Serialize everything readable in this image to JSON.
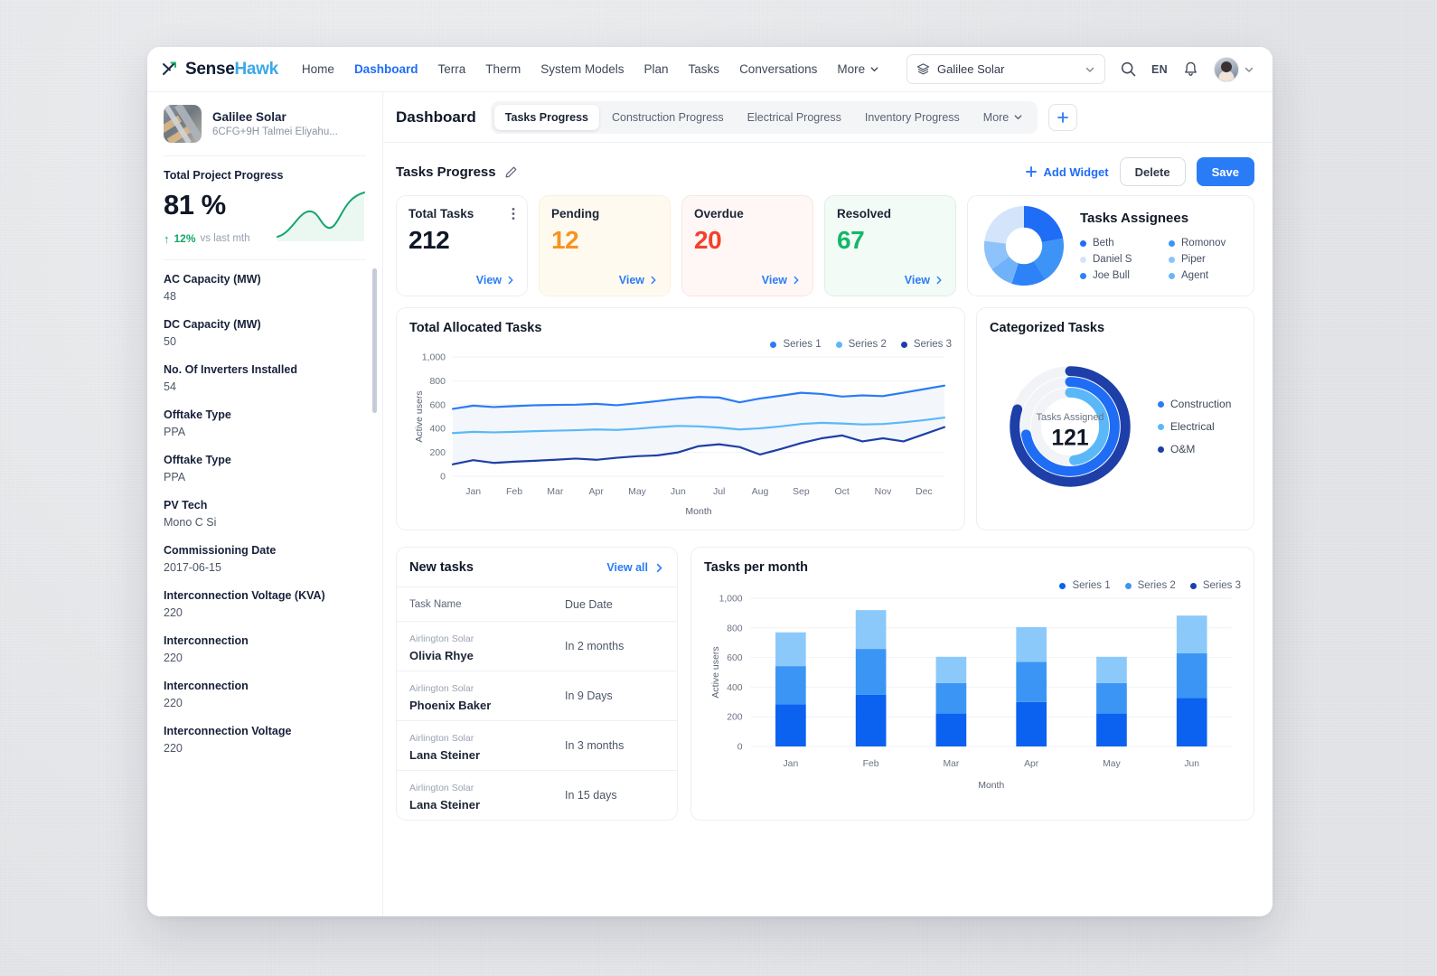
{
  "brand": {
    "name_part1": "Sense",
    "name_part2": "Hawk",
    "logo_icon": "sensehawk-arrows-icon"
  },
  "nav": {
    "links": [
      {
        "label": "Home",
        "active": false
      },
      {
        "label": "Dashboard",
        "active": true
      },
      {
        "label": "Terra",
        "active": false
      },
      {
        "label": "Therm",
        "active": false
      },
      {
        "label": "System Models",
        "active": false
      },
      {
        "label": "Plan",
        "active": false
      },
      {
        "label": "Tasks",
        "active": false
      },
      {
        "label": "Conversations",
        "active": false
      },
      {
        "label": "More",
        "active": false
      }
    ],
    "project_selector": {
      "value": "Galilee Solar",
      "icon": "layers-icon",
      "chevron": "chevron-down-icon"
    },
    "search_icon": "search-icon",
    "language": "EN",
    "notifications_icon": "bell-icon",
    "avatar_icon": "user-avatar"
  },
  "sidebar": {
    "project": {
      "name": "Galilee Solar",
      "address": "6CFG+9H Talmei Eliyahu..."
    },
    "progress": {
      "label": "Total Project Progress",
      "value": "81 %",
      "delta": "12%",
      "delta_note": "vs last mth",
      "delta_color": "#12a868",
      "sparkline": [
        6,
        10,
        22,
        40,
        52,
        55,
        48,
        38,
        35,
        42,
        60,
        78,
        86,
        88
      ]
    },
    "attributes": [
      {
        "key": "AC Capacity (MW)",
        "value": "48"
      },
      {
        "key": "DC Capacity (MW)",
        "value": "50"
      },
      {
        "key": "No. Of Inverters Installed",
        "value": "54"
      },
      {
        "key": "Offtake Type",
        "value": "PPA"
      },
      {
        "key": "Offtake Type",
        "value": "PPA"
      },
      {
        "key": "PV Tech",
        "value": "Mono C Si"
      },
      {
        "key": "Commissioning Date",
        "value": "2017-06-15"
      },
      {
        "key": "Interconnection Voltage (KVA)",
        "value": "220"
      },
      {
        "key": "Interconnection",
        "value": "220"
      },
      {
        "key": "Interconnection",
        "value": "220"
      },
      {
        "key": "Interconnection Voltage",
        "value": "220"
      }
    ]
  },
  "main": {
    "page_title": "Dashboard",
    "tabs": [
      {
        "label": "Tasks Progress",
        "active": true
      },
      {
        "label": "Construction Progress",
        "active": false
      },
      {
        "label": "Electrical Progress",
        "active": false
      },
      {
        "label": "Inventory Progress",
        "active": false
      },
      {
        "label": "More",
        "active": false
      }
    ],
    "add_tab_icon": "plus-icon",
    "widget_title": "Tasks Progress",
    "edit_icon": "pencil-icon",
    "add_widget_label": "Add Widget",
    "delete_label": "Delete",
    "save_label": "Save"
  },
  "kpis": [
    {
      "label": "Total Tasks",
      "value": "212",
      "view": "View",
      "color": "#101828"
    },
    {
      "label": "Pending",
      "value": "12",
      "view": "View",
      "color": "#f5941f"
    },
    {
      "label": "Overdue",
      "value": "20",
      "view": "View",
      "color": "#f4402c"
    },
    {
      "label": "Resolved",
      "value": "67",
      "view": "View",
      "color": "#12b76a"
    }
  ],
  "assignees": {
    "title": "Tasks Assignees",
    "legend": [
      {
        "name": "Beth",
        "color": "#1f6df5"
      },
      {
        "name": "Romonov",
        "color": "#3d94f6"
      },
      {
        "name": "Daniel S",
        "color": "#d4e5fb"
      },
      {
        "name": "Piper",
        "color": "#8dc2fb"
      },
      {
        "name": "Joe Bull",
        "color": "#2d82f7"
      },
      {
        "name": "Agent",
        "color": "#6fb2fa"
      }
    ]
  },
  "chart_data": [
    {
      "type": "line",
      "title": "Total Allocated Tasks",
      "xlabel": "Month",
      "ylabel": "Active users",
      "ylim": [
        0,
        1000
      ],
      "yticks": [
        0,
        200,
        400,
        600,
        800,
        1000
      ],
      "ytick_labels": [
        "0",
        "200",
        "400",
        "600",
        "800",
        "1,000"
      ],
      "categories": [
        "Jan",
        "Feb",
        "Mar",
        "Apr",
        "May",
        "Jun",
        "Jul",
        "Aug",
        "Sep",
        "Oct",
        "Nov",
        "Dec"
      ],
      "grid": true,
      "legend_position": "top-right",
      "series": [
        {
          "name": "Series 1",
          "color": "#2a7cf6",
          "values": [
            565,
            592,
            580,
            588,
            595,
            598,
            600,
            607,
            595,
            612,
            630,
            650,
            665,
            660,
            620,
            652,
            675,
            700,
            690,
            668,
            678,
            672,
            700,
            730,
            760
          ]
        },
        {
          "name": "Series 2",
          "color": "#5ab8f8",
          "values": [
            362,
            372,
            368,
            372,
            378,
            382,
            386,
            392,
            388,
            398,
            412,
            422,
            418,
            408,
            392,
            402,
            418,
            438,
            448,
            442,
            434,
            438,
            452,
            470,
            492
          ]
        },
        {
          "name": "Series 3",
          "color": "#1e3fa8",
          "values": [
            100,
            135,
            112,
            122,
            130,
            138,
            148,
            138,
            155,
            168,
            175,
            200,
            252,
            268,
            245,
            182,
            228,
            278,
            318,
            342,
            292,
            318,
            292,
            352,
            412
          ]
        }
      ]
    },
    {
      "type": "donut",
      "title": "Tasks Assignees",
      "slices": [
        {
          "name": "Beth",
          "value": 22,
          "color": "#1f6df5"
        },
        {
          "name": "Romonov",
          "value": 19,
          "color": "#3d94f6"
        },
        {
          "name": "Joe Bull",
          "value": 14,
          "color": "#2d82f7"
        },
        {
          "name": "Agent",
          "value": 10,
          "color": "#6fb2fa"
        },
        {
          "name": "Piper",
          "value": 12,
          "color": "#8dc2fb"
        },
        {
          "name": "Daniel S",
          "value": 23,
          "color": "#d4e5fb"
        }
      ]
    },
    {
      "type": "donut",
      "title": "Categorized Tasks",
      "center_label": "Tasks Assigned",
      "center_value": "121",
      "rings": [
        {
          "name": "O&M",
          "color": "#1e3fa8",
          "fraction": 0.8
        },
        {
          "name": "Construction",
          "color": "#1f6df5",
          "fraction": 0.72
        },
        {
          "name": "Electrical",
          "color": "#5ab8f8",
          "fraction": 0.48
        }
      ],
      "legend": [
        {
          "name": "Construction",
          "color": "#2a7cf6"
        },
        {
          "name": "Electrical",
          "color": "#5ab8f8"
        },
        {
          "name": "O&M",
          "color": "#1e3fa8"
        }
      ]
    },
    {
      "type": "bar",
      "title": "Tasks per month",
      "xlabel": "Month",
      "ylabel": "Active users",
      "ylim": [
        0,
        1000
      ],
      "yticks": [
        0,
        200,
        400,
        600,
        800,
        1000
      ],
      "ytick_labels": [
        "0",
        "200",
        "400",
        "600",
        "800",
        "1,000"
      ],
      "categories": [
        "Jan",
        "Feb",
        "Mar",
        "Apr",
        "May",
        "Jun"
      ],
      "stacked": true,
      "grid": true,
      "legend_position": "top-right",
      "series": [
        {
          "name": "Series 1",
          "color": "#0b61f0",
          "values": [
            285,
            348,
            222,
            300,
            222,
            328
          ]
        },
        {
          "name": "Series 2",
          "color": "#3b95f5",
          "values": [
            257,
            310,
            205,
            270,
            205,
            300
          ]
        },
        {
          "name": "Series 3",
          "color": "#8cc9fb",
          "values": [
            228,
            262,
            178,
            235,
            178,
            255
          ]
        }
      ]
    }
  ],
  "categorized": {
    "title": "Categorized Tasks",
    "center_label": "Tasks Assigned",
    "center_value": "121",
    "legend": [
      {
        "name": "Construction",
        "color": "#2a7cf6"
      },
      {
        "name": "Electrical",
        "color": "#5ab8f8"
      },
      {
        "name": "O&M",
        "color": "#1e3fa8"
      }
    ]
  },
  "new_tasks": {
    "title": "New tasks",
    "view_all": "View all",
    "columns": [
      "Task Name",
      "Due Date"
    ],
    "rows": [
      {
        "sub": "Airlington Solar",
        "name": "Olivia Rhye",
        "due": "In 2 months"
      },
      {
        "sub": "Airlington Solar",
        "name": "Phoenix Baker",
        "due": "In 9 Days"
      },
      {
        "sub": "Airlington Solar",
        "name": "Lana Steiner",
        "due": "In 3 months"
      },
      {
        "sub": "Airlington Solar",
        "name": "Lana Steiner",
        "due": "In 15 days"
      }
    ]
  },
  "line_chart_title": "Total Allocated Tasks",
  "bar_chart_title": "Tasks per month"
}
